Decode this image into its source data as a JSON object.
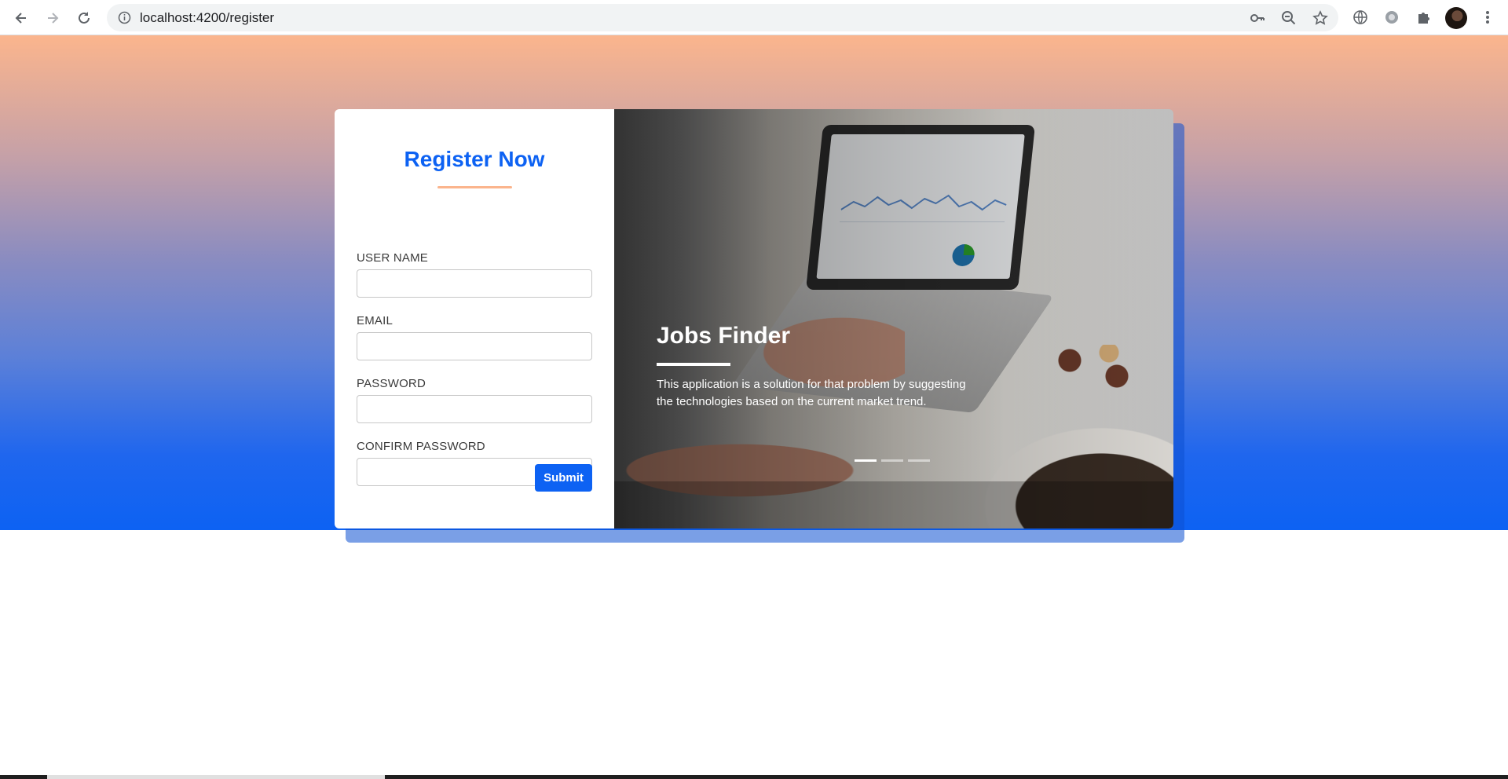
{
  "browser": {
    "url": "localhost:4200/register",
    "icons": [
      "back-icon",
      "forward-icon",
      "reload-icon",
      "info-icon",
      "key-icon",
      "zoom-icon",
      "star-icon",
      "globe-icon",
      "extension-icon",
      "puzzle-icon",
      "avatar",
      "menu-icon"
    ]
  },
  "register": {
    "title": "Register Now",
    "fields": [
      {
        "label": "USER NAME",
        "value": ""
      },
      {
        "label": "EMAIL",
        "value": ""
      },
      {
        "label": "PASSWORD",
        "value": ""
      },
      {
        "label": "CONFIRM PASSWORD",
        "value": ""
      }
    ],
    "submit_label": "Submit"
  },
  "carousel": {
    "caption_title": "Jobs Finder",
    "caption_text": "This application is a solution for that problem by suggesting the technologies based on the current market trend.",
    "slide_count": 3,
    "active_slide": 1
  },
  "colors": {
    "brand_blue": "#0d62f3",
    "accent_peach": "#fbb58d"
  }
}
